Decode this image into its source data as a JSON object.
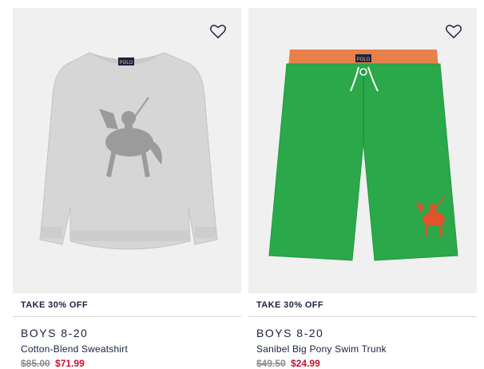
{
  "products": [
    {
      "promo": "TAKE 30% OFF",
      "category": "BOYS 8-20",
      "name": "Cotton-Blend Sweatshirt",
      "old_price": "$85.00",
      "sale_price": "$71.99",
      "product_color": "#d6d6d6",
      "logo_label": "POLO"
    },
    {
      "promo": "TAKE 30% OFF",
      "category": "BOYS 8-20",
      "name": "Sanibel Big Pony Swim Trunk",
      "old_price": "$49.50",
      "sale_price": "$24.99",
      "product_color": "#2aa84a",
      "logo_label": "POLO"
    }
  ],
  "colors": {
    "navy": "#1a2340",
    "sale_red": "#c8102e",
    "image_bg": "#f0f0f0"
  },
  "icons": [
    "heart-outline-icon"
  ]
}
